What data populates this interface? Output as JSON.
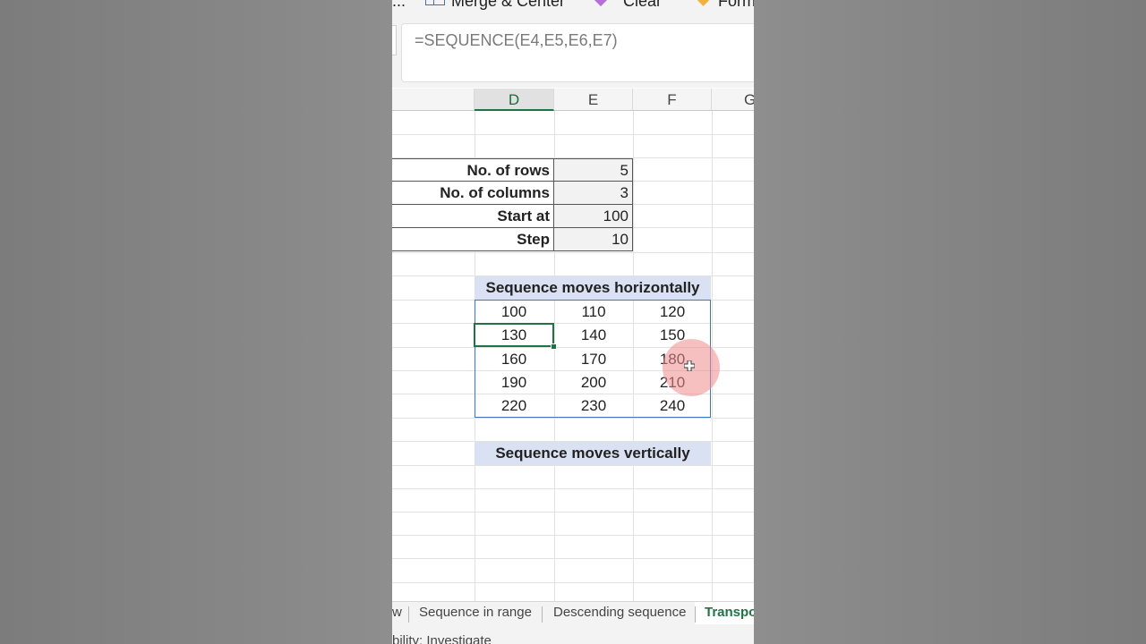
{
  "ribbon": {
    "items": [
      {
        "label": "..."
      },
      {
        "label": "Merge & Center"
      },
      {
        "label": "Clear"
      },
      {
        "label": "Form"
      }
    ]
  },
  "formula_bar": {
    "formula": "=SEQUENCE(E4,E5,E6,E7)"
  },
  "columns": [
    "D",
    "E",
    "F",
    "G"
  ],
  "active_column": "D",
  "params": [
    {
      "label": "No. of rows",
      "value": "5"
    },
    {
      "label": "No. of columns",
      "value": "3"
    },
    {
      "label": "Start at",
      "value": "100"
    },
    {
      "label": "Step",
      "value": "10"
    }
  ],
  "sequence_horizontal": {
    "title": "Sequence moves horizontally",
    "rows": [
      [
        "100",
        "110",
        "120"
      ],
      [
        "130",
        "140",
        "150"
      ],
      [
        "160",
        "170",
        "180"
      ],
      [
        "190",
        "200",
        "210"
      ],
      [
        "220",
        "230",
        "240"
      ]
    ]
  },
  "sequence_vertical": {
    "title": "Sequence moves vertically"
  },
  "sheet_tabs": [
    {
      "label": "w",
      "active": false
    },
    {
      "label": "Sequence in range",
      "active": false
    },
    {
      "label": "Descending sequence",
      "active": false
    },
    {
      "label": "Transpo",
      "active": true
    }
  ],
  "status_bar": {
    "text": "bility: Investigate"
  },
  "colors": {
    "accent": "#217346",
    "header_band": "#d9e1f2",
    "sequence_border": "#4472c4"
  }
}
